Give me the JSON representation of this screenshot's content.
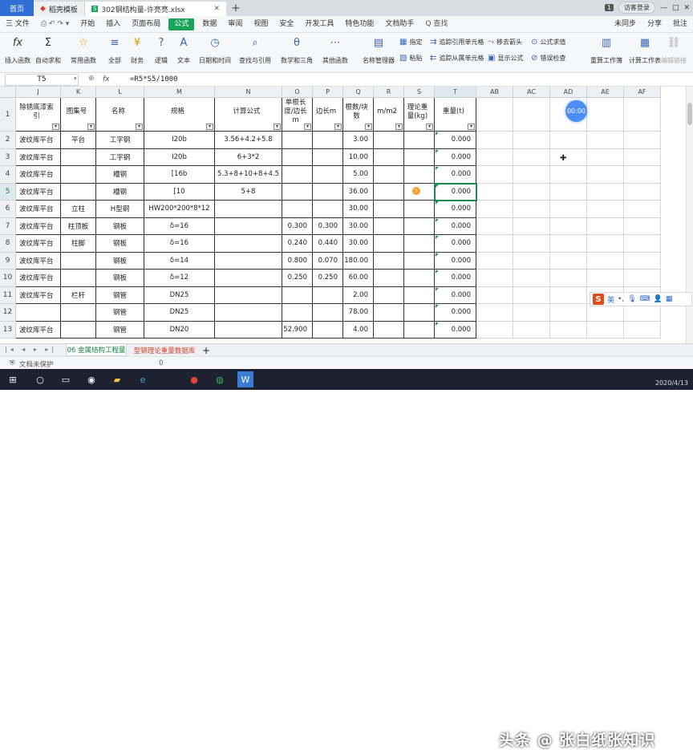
{
  "tabs": {
    "home": "首页",
    "doc_template": "稻壳模板",
    "active_file": "302钢结构量-许亮亮.xlsx",
    "new_tab": "+"
  },
  "window": {
    "badge": "1",
    "login": "访客登录"
  },
  "menu": {
    "file": "三 文件",
    "items": [
      "开始",
      "插入",
      "页面布局",
      "公式",
      "数据",
      "审阅",
      "视图",
      "安全",
      "开发工具",
      "特色功能",
      "文档助手"
    ],
    "active": "公式",
    "search": "Q 查找",
    "unsync": "未同步",
    "share": "分享",
    "comment": "批注"
  },
  "ribbon": {
    "insert_func": "插入函数",
    "autosum": "自动求和",
    "common_func": "常用函数",
    "all": "全部",
    "finance": "财务",
    "logic": "逻辑",
    "text": "文本",
    "datetime": "日期和时间",
    "lookup": "查找与引用",
    "math": "数学和三角",
    "other": "其他函数",
    "name_mgr": "名称管理器",
    "specify": "指定",
    "paste": "粘贴",
    "trace_prec": "追踪引用单元格",
    "trace_dep": "追踪从属单元格",
    "remove_arrows": "移去箭头",
    "show_formula": "显示公式",
    "formula_eval": "公式求值",
    "error_check": "错误检查",
    "recalc_book": "重算工作簿",
    "calc_sheet": "计算工作表",
    "edit_link": "编辑链接"
  },
  "formula_bar": {
    "name_box": "T5",
    "fx": "fx",
    "formula": "=R5*S5/1000"
  },
  "columns": [
    "J",
    "K",
    "L",
    "M",
    "N",
    "O",
    "P",
    "Q",
    "R",
    "S",
    "T",
    "AB",
    "AC",
    "AD",
    "AE",
    "AF"
  ],
  "header_row": {
    "J": "除锈底漆索引",
    "K": "图集号",
    "L": "名称",
    "M": "规格",
    "N": "计算公式",
    "O": "单根长度/边长m",
    "P": "边长m",
    "Q": "根数/块数",
    "R": "m/m2",
    "S": "理论重量(kg)",
    "T": "重量(t)"
  },
  "rows": [
    {
      "num": "1"
    },
    {
      "num": "2",
      "J": "波纹库平台",
      "K": "平台",
      "L": "工字钢",
      "M": "I20b",
      "N": "3.56+4.2+5.8",
      "O": "",
      "P": "",
      "Q": "3.00",
      "T": "0.000"
    },
    {
      "num": "3",
      "J": "波纹库平台",
      "K": "",
      "L": "工字钢",
      "M": "I20b",
      "N": "6+3*2",
      "O": "",
      "P": "",
      "Q": "10.00",
      "T": "0.000"
    },
    {
      "num": "4",
      "J": "波纹库平台",
      "K": "",
      "L": "槽钢",
      "M": "[16b",
      "N": "5.3+8+10+8+4.5",
      "O": "",
      "P": "",
      "Q": "5.00",
      "T": "0.000"
    },
    {
      "num": "5",
      "J": "波纹库平台",
      "K": "",
      "L": "槽钢",
      "M": "[10",
      "N": "5+8",
      "O": "",
      "P": "",
      "Q": "36.00",
      "T": "0.000"
    },
    {
      "num": "6",
      "J": "波纹库平台",
      "K": "立柱",
      "L": "H型钢",
      "M": "HW200*200*8*12",
      "N": "",
      "O": "",
      "P": "",
      "Q": "30.00",
      "T": "0.000"
    },
    {
      "num": "7",
      "J": "波纹库平台",
      "K": "柱顶板",
      "L": "钢板",
      "M": "δ=16",
      "N": "",
      "O": "0.300",
      "P": "0.300",
      "Q": "30.00",
      "T": "0.000"
    },
    {
      "num": "8",
      "J": "波纹库平台",
      "K": "柱脚",
      "L": "钢板",
      "M": "δ=16",
      "N": "",
      "O": "0.240",
      "P": "0.440",
      "Q": "30.00",
      "T": "0.000"
    },
    {
      "num": "9",
      "J": "波纹库平台",
      "K": "",
      "L": "钢板",
      "M": "δ=14",
      "N": "",
      "O": "0.800",
      "P": "0.070",
      "Q": "180.00",
      "T": "0.000"
    },
    {
      "num": "10",
      "J": "波纹库平台",
      "K": "",
      "L": "钢板",
      "M": "δ=12",
      "N": "",
      "O": "0.250",
      "P": "0.250",
      "Q": "60.00",
      "T": "0.000"
    },
    {
      "num": "11",
      "J": "波纹库平台",
      "K": "栏杆",
      "L": "钢管",
      "M": "DN25",
      "N": "",
      "O": "",
      "P": "",
      "Q": "2.00",
      "T": "0.000"
    },
    {
      "num": "12",
      "J": "",
      "K": "",
      "L": "钢管",
      "M": "DN25",
      "N": "",
      "O": "",
      "P": "",
      "Q": "78.00",
      "T": "0.000"
    },
    {
      "num": "13",
      "J": "波纹库平台",
      "K": "",
      "L": "钢管",
      "M": "DN20",
      "N": "",
      "O": "52.900",
      "P": "",
      "Q": "4.00",
      "T": "0.000"
    }
  ],
  "timer": "00:00",
  "ime": {
    "logo": "S",
    "lang": "英"
  },
  "sheet_tabs": {
    "tab1": "06 金属结构工程量",
    "tab2": "型钢理论重量数据库"
  },
  "status": {
    "protect": "文档未保护",
    "zero": "0"
  },
  "taskbar": {
    "watermark": "头条 @ 张白纸张知识",
    "date": "2020/4/13"
  }
}
